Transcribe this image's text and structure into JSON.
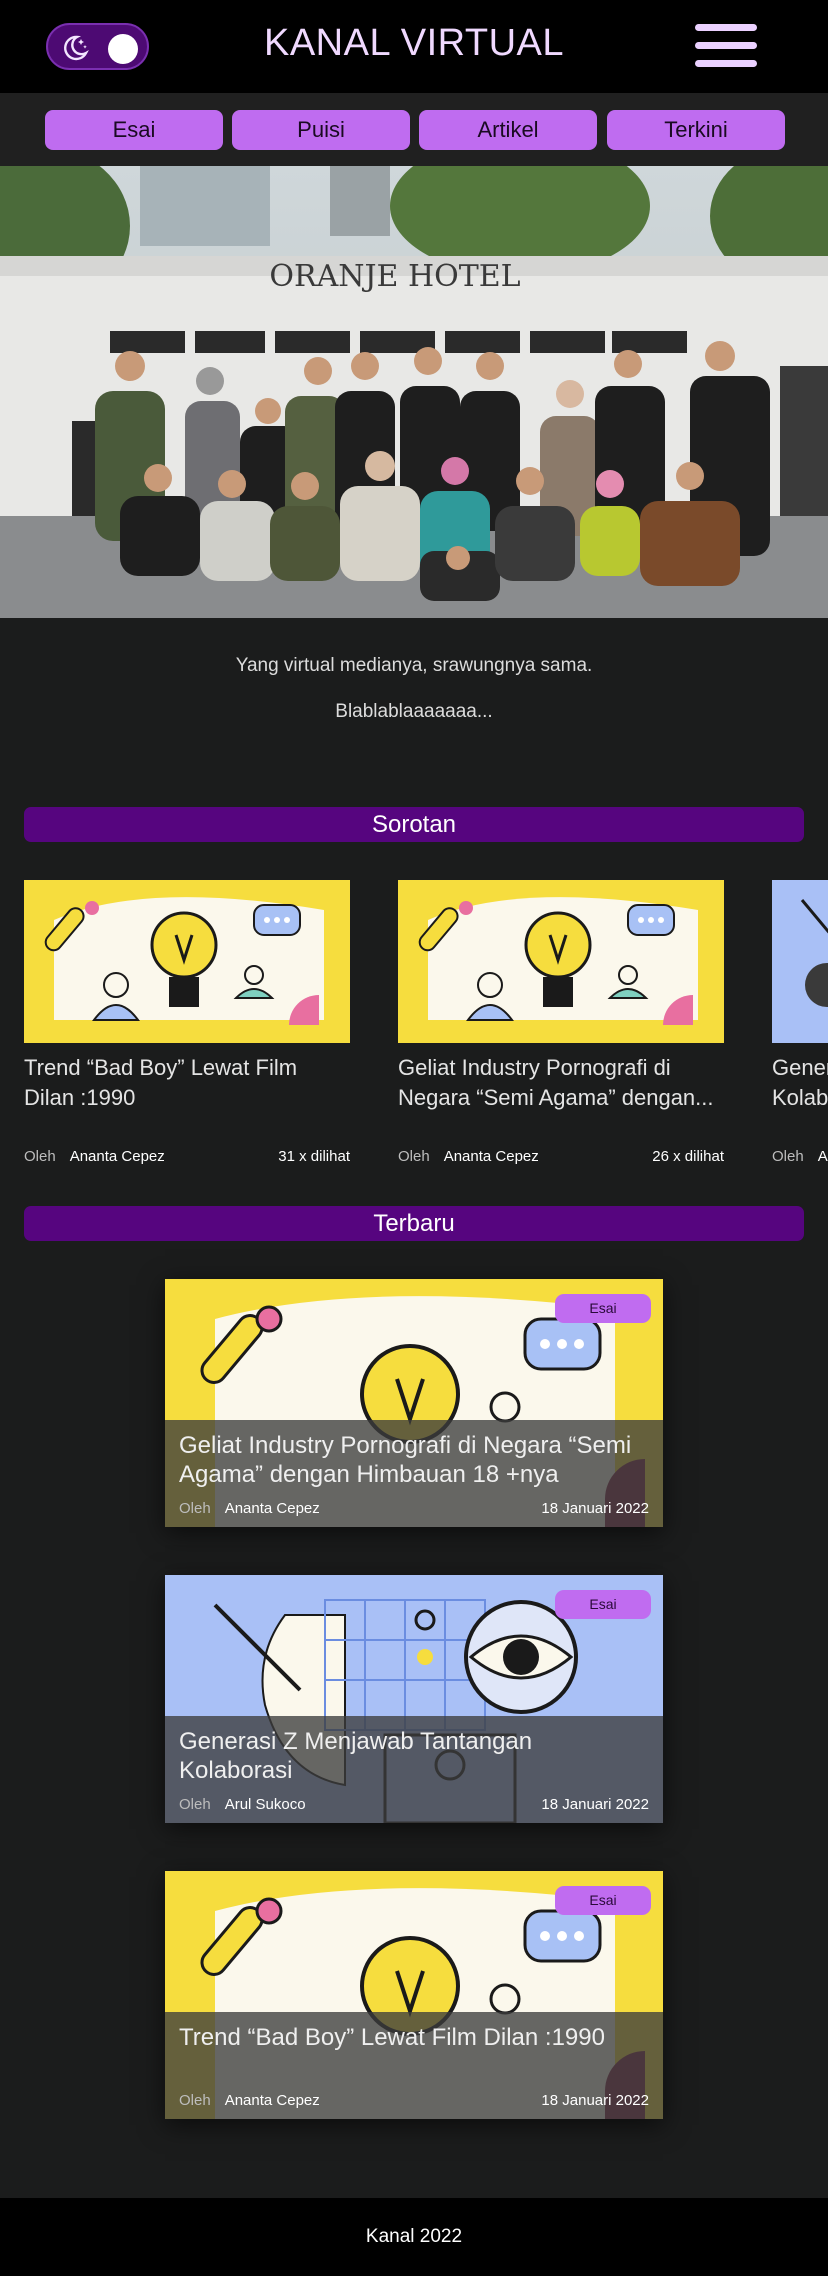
{
  "header": {
    "title": "KANAL VIRTUAL",
    "theme_toggle_icon": "moon-stars-icon",
    "menu_icon": "hamburger-icon"
  },
  "nav": {
    "items": [
      {
        "label": "Esai"
      },
      {
        "label": "Puisi"
      },
      {
        "label": "Artikel"
      },
      {
        "label": "Terkini"
      }
    ]
  },
  "hero": {
    "sign_text": "ORANJE HOTEL",
    "tagline_1": "Yang virtual medianya, srawungnya sama.",
    "tagline_2": "Blablablaaaaaaa..."
  },
  "sorotan": {
    "heading": "Sorotan",
    "cards": [
      {
        "title": "Trend “Bad Boy” Lewat Film Dilan :1990",
        "by": "Oleh",
        "author": "Ananta Cepez",
        "views": "31 x dilihat"
      },
      {
        "title": "Geliat Industry Pornografi di Negara “Semi Agama” dengan...",
        "by": "Oleh",
        "author": "Ananta Cepez",
        "views": "26 x dilihat"
      },
      {
        "title": "Generasi Z Menjawab Tantangan Kolaborasi",
        "by": "Oleh",
        "author": "Arul Sukoco",
        "views": ""
      }
    ]
  },
  "terbaru": {
    "heading": "Terbaru",
    "posts": [
      {
        "badge": "Esai",
        "title": "Geliat Industry Pornografi di Negara “Semi Agama” dengan Himbauan 18 +nya",
        "by": "Oleh",
        "author": "Ananta Cepez",
        "date": "18 Januari 2022"
      },
      {
        "badge": "Esai",
        "title": "Generasi Z Menjawab Tantangan Kolaborasi",
        "by": "Oleh",
        "author": "Arul Sukoco",
        "date": "18 Januari 2022"
      },
      {
        "badge": "Esai",
        "title": "Trend “Bad Boy” Lewat Film Dilan :1990",
        "by": "Oleh",
        "author": "Ananta Cepez",
        "date": "18 Januari 2022"
      }
    ]
  },
  "footer": {
    "text": "Kanal 2022"
  },
  "colors": {
    "accent": "#bf6cf0",
    "section_bar": "#56057f",
    "background": "#1b1c1c"
  }
}
